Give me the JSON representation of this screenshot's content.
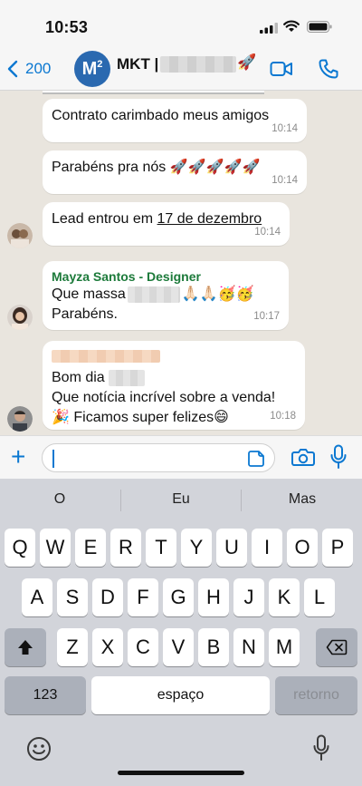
{
  "status": {
    "time": "10:53"
  },
  "header": {
    "back_count": "200",
    "avatar_letter": "M",
    "avatar_sup": "2",
    "title": "MKT |",
    "title_emoji": "🚀"
  },
  "messages": [
    {
      "text": "Contrato carimbado meus amigos",
      "time": "10:14"
    },
    {
      "text": "Parabéns pra nós 🚀🚀🚀🚀🚀",
      "time": "10:14"
    },
    {
      "text_pre": "Lead entrou em ",
      "text_link": "17 de dezembro",
      "time": "10:14"
    },
    {
      "sender": "Mayza Santos - Designer",
      "line1_pre": "Que massa",
      "line1_post": "🙏🏻🙏🏻🥳🥳",
      "line2": "Parabéns.",
      "time": "10:17"
    },
    {
      "line1": "Bom dia",
      "line2": "Que notícia incrível sobre a venda!",
      "line3": "🎉 Ficamos super felizes😄",
      "time": "10:18"
    }
  ],
  "keyboard": {
    "suggestions": [
      "O",
      "Eu",
      "Mas"
    ],
    "row1": [
      "Q",
      "W",
      "E",
      "R",
      "T",
      "Y",
      "U",
      "I",
      "O",
      "P"
    ],
    "row2": [
      "A",
      "S",
      "D",
      "F",
      "G",
      "H",
      "J",
      "K",
      "L"
    ],
    "row3": [
      "Z",
      "X",
      "C",
      "V",
      "B",
      "N",
      "M"
    ],
    "numbers_label": "123",
    "space_label": "espaço",
    "return_label": "retorno"
  },
  "colors": {
    "accent": "#0b78d1",
    "sender": "#1c7a3a",
    "chat_bg": "#e9e5de"
  }
}
